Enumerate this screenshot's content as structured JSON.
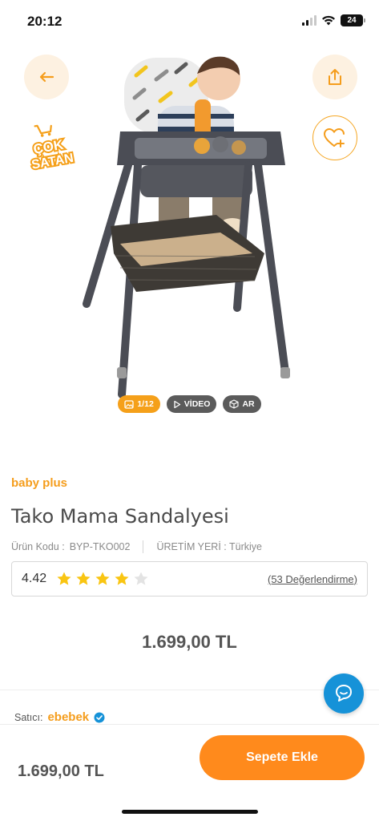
{
  "status_bar": {
    "time": "20:12",
    "battery": "24"
  },
  "hero": {
    "badge_line1": "ÇOK",
    "badge_line2": "SATAN",
    "image_counter": "1/12",
    "video_label": "VİDEO",
    "ar_label": "AR"
  },
  "product": {
    "brand": "baby plus",
    "title": "Tako Mama Sandalyesi",
    "code_label": "Ürün Kodu :",
    "code_value": "BYP-TKO002",
    "origin": "ÜRETİM YERİ : Türkiye",
    "rating": "4.42",
    "rating_stars": 4,
    "reviews": "(53 Değerlendirme)",
    "price": "1.699,00 TL"
  },
  "seller": {
    "label": "Satıcı:",
    "name": "ebebek"
  },
  "bottom_bar": {
    "price": "1.699,00 TL",
    "cta": "Sepete Ekle"
  },
  "colors": {
    "accent": "#ff8a1c",
    "brand": "#f59d1c",
    "chat": "#1692d8",
    "star": "#f9c512"
  },
  "icons": [
    "back-arrow-icon",
    "share-icon",
    "heart-plus-icon",
    "image-icon",
    "play-icon",
    "cube-icon",
    "star-icon",
    "chat-icon",
    "verified-icon"
  ]
}
